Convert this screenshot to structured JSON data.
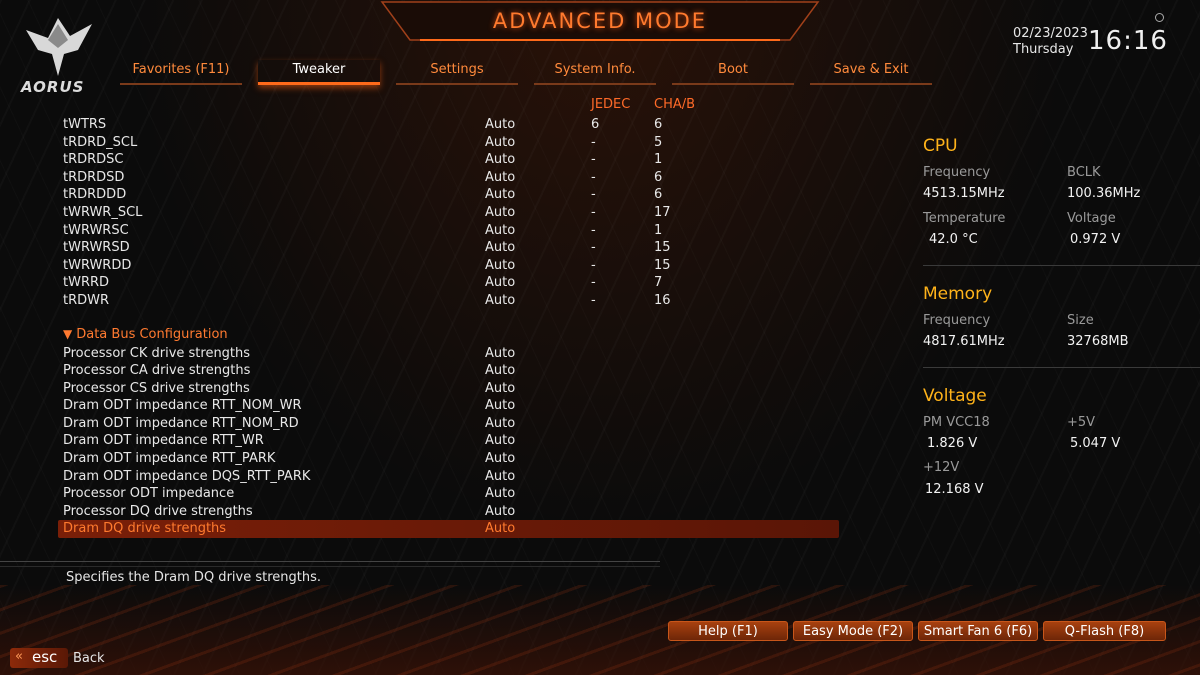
{
  "header": {
    "title": "ADVANCED MODE",
    "logo_text": "AORUS",
    "date": "02/23/2023",
    "day": "Thursday",
    "time": "16:16"
  },
  "tabs": [
    {
      "label": "Favorites (F11)",
      "active": false
    },
    {
      "label": "Tweaker",
      "active": true
    },
    {
      "label": "Settings",
      "active": false
    },
    {
      "label": "System Info.",
      "active": false
    },
    {
      "label": "Boot",
      "active": false
    },
    {
      "label": "Save & Exit",
      "active": false
    }
  ],
  "columns": {
    "jedec": "JEDEC",
    "chab": "CHA/B"
  },
  "timings": [
    {
      "name": "tWTRS",
      "value": "Auto",
      "jedec": "6",
      "chab": "6"
    },
    {
      "name": "tRDRD_SCL",
      "value": "Auto",
      "jedec": "-",
      "chab": "5"
    },
    {
      "name": "tRDRDSC",
      "value": "Auto",
      "jedec": "-",
      "chab": "1"
    },
    {
      "name": "tRDRDSD",
      "value": "Auto",
      "jedec": "-",
      "chab": "6"
    },
    {
      "name": "tRDRDDD",
      "value": "Auto",
      "jedec": "-",
      "chab": "6"
    },
    {
      "name": "tWRWR_SCL",
      "value": "Auto",
      "jedec": "-",
      "chab": "17"
    },
    {
      "name": "tWRWRSC",
      "value": "Auto",
      "jedec": "-",
      "chab": "1"
    },
    {
      "name": "tWRWRSD",
      "value": "Auto",
      "jedec": "-",
      "chab": "15"
    },
    {
      "name": "tWRWRDD",
      "value": "Auto",
      "jedec": "-",
      "chab": "15"
    },
    {
      "name": "tWRRD",
      "value": "Auto",
      "jedec": "-",
      "chab": "7"
    },
    {
      "name": "tRDWR",
      "value": "Auto",
      "jedec": "-",
      "chab": "16"
    }
  ],
  "section": {
    "arrow": "▼",
    "label": "Data Bus Configuration"
  },
  "bus_settings": [
    {
      "name": "Processor CK drive strengths",
      "value": "Auto"
    },
    {
      "name": "Processor CA drive strengths",
      "value": "Auto"
    },
    {
      "name": "Processor CS drive strengths",
      "value": "Auto"
    },
    {
      "name": "Dram ODT impedance RTT_NOM_WR",
      "value": "Auto"
    },
    {
      "name": "Dram ODT impedance RTT_NOM_RD",
      "value": "Auto"
    },
    {
      "name": "Dram ODT impedance RTT_WR",
      "value": "Auto"
    },
    {
      "name": "Dram ODT impedance RTT_PARK",
      "value": "Auto"
    },
    {
      "name": "Dram ODT impedance DQS_RTT_PARK",
      "value": "Auto"
    },
    {
      "name": "Processor ODT impedance",
      "value": "Auto"
    },
    {
      "name": "Processor DQ drive strengths",
      "value": "Auto"
    },
    {
      "name": "Dram DQ drive strengths",
      "value": "Auto",
      "selected": true
    }
  ],
  "description": "Specifies the Dram DQ drive strengths.",
  "panel": {
    "cpu": {
      "title": "CPU",
      "freq_label": "Frequency",
      "freq": "4513.15MHz",
      "bclk_label": "BCLK",
      "bclk": "100.36MHz",
      "temp_label": "Temperature",
      "temp": "42.0 °C",
      "volt_label": "Voltage",
      "volt": "0.972 V"
    },
    "memory": {
      "title": "Memory",
      "freq_label": "Frequency",
      "freq": "4817.61MHz",
      "size_label": "Size",
      "size": "32768MB"
    },
    "voltage": {
      "title": "Voltage",
      "pm_label": "PM VCC18",
      "pm": "1.826 V",
      "v5_label": "+5V",
      "v5": "5.047 V",
      "v12_label": "+12V",
      "v12": "12.168 V"
    }
  },
  "footer": {
    "help": "Help (F1)",
    "easy": "Easy Mode (F2)",
    "fan": "Smart Fan 6 (F6)",
    "qflash": "Q-Flash (F8)",
    "esc_chevron": "«",
    "esc": "esc",
    "back": "Back"
  },
  "colors": {
    "accent": "#ff6a1a",
    "section": "#ff7a30",
    "panel_title": "#ffb31a",
    "selected_bg": "#7a1f08"
  },
  "icons": [
    "aorus-eagle-icon",
    "settings-gear-icon",
    "triangle-down-icon",
    "double-chevron-left-icon"
  ]
}
